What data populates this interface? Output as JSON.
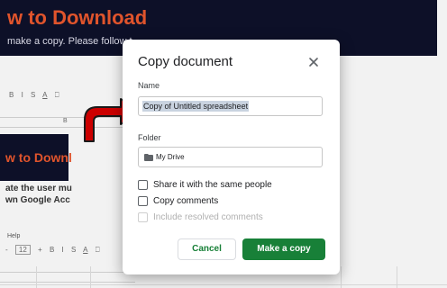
{
  "background": {
    "banner_title": "w to Download",
    "banner_subtitle": "make a copy. Please follow t",
    "toolbar_top": [
      "B",
      "I",
      "S",
      "A",
      "⎕"
    ],
    "toolbar_bottom": [
      "-",
      "12",
      "+",
      "B",
      "I",
      "S",
      "A",
      "⎕"
    ],
    "column_letter": "B",
    "dark_box_title": "w to Downl",
    "text_line1": "ate the user mu",
    "text_line2": "wn Google Acc",
    "help_text": "Help",
    "accent_color": "#e0542c",
    "banner_color": "#0d1028"
  },
  "dialog": {
    "title": "Copy document",
    "close_icon": "close-icon",
    "name_label": "Name",
    "name_value": "Copy of Untitled spreadsheet",
    "folder_label": "Folder",
    "folder_icon": "folder-icon",
    "folder_value": "My Drive",
    "checkboxes": [
      {
        "label": "Share it with the same people",
        "checked": false,
        "disabled": false
      },
      {
        "label": "Copy comments",
        "checked": false,
        "disabled": false
      },
      {
        "label": "Include resolved comments",
        "checked": false,
        "disabled": true
      }
    ],
    "cancel_label": "Cancel",
    "confirm_label": "Make a copy",
    "primary_color": "#188038"
  },
  "annotation": {
    "arrow_color": "#cc0000",
    "arrow_icon": "curved-arrow-icon"
  }
}
